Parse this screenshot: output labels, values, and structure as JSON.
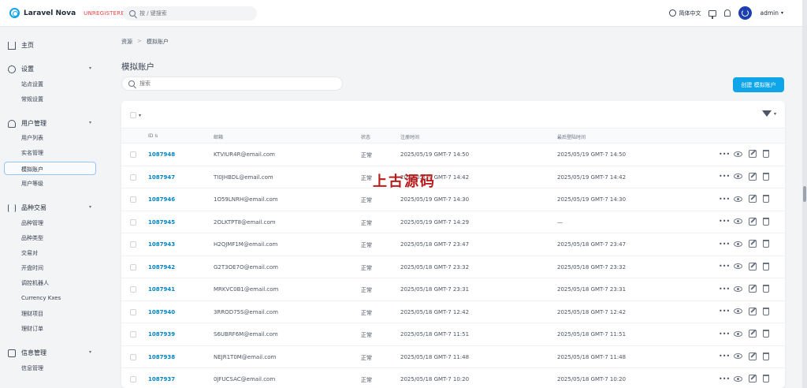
{
  "app": {
    "name": "Laravel Nova",
    "badge": "UNREGISTERED"
  },
  "global_search": {
    "placeholder": "按 / 键搜索"
  },
  "topbar": {
    "language": "简体中文",
    "user": "admin"
  },
  "sidebar": {
    "groups": [
      {
        "label": "主页",
        "items": []
      },
      {
        "label": "设置",
        "items": [
          "站点设置",
          "常规设置"
        ]
      },
      {
        "label": "用户管理",
        "items": [
          "用户列表",
          "实名管理",
          "模拟账户",
          "用户等级"
        ]
      },
      {
        "label": "品种交易",
        "items": [
          "品种管理",
          "品种类型",
          "交易对",
          "开盘时间",
          "调控机器人",
          "Currency Kxes",
          "理财项目",
          "理财订单"
        ]
      },
      {
        "label": "信息管理",
        "items": [
          "信息管理"
        ]
      }
    ],
    "active_item": "模拟账户"
  },
  "breadcrumb": {
    "root": "资源",
    "separator": ">",
    "current": "模拟账户"
  },
  "page": {
    "title": "模拟账户",
    "search_placeholder": "搜索",
    "create_button": "创建 模拟账户"
  },
  "table": {
    "columns": {
      "id": "ID",
      "email": "邮箱",
      "status": "状态",
      "registered": "注册时间",
      "last_login": "最后登陆时间"
    },
    "rows": [
      {
        "id": "1087948",
        "email": "KTVIUR4R@email.com",
        "status": "正常",
        "registered": "2025/05/19 GMT-7 14:50",
        "last_login": "2025/05/19 GMT-7 14:50"
      },
      {
        "id": "1087947",
        "email": "TI0JHBDL@email.com",
        "status": "正常",
        "registered": "2025/05/19 GMT-7 14:42",
        "last_login": "2025/05/19 GMT-7 14:42"
      },
      {
        "id": "1087946",
        "email": "1O59LNRH@email.com",
        "status": "正常",
        "registered": "2025/05/19 GMT-7 14:30",
        "last_login": "2025/05/19 GMT-7 14:30"
      },
      {
        "id": "1087945",
        "email": "2OLKTPT8@email.com",
        "status": "正常",
        "registered": "2025/05/19 GMT-7 14:29",
        "last_login": "—"
      },
      {
        "id": "1087943",
        "email": "H2QJMF1M@email.com",
        "status": "正常",
        "registered": "2025/05/18 GMT-7 23:47",
        "last_login": "2025/05/18 GMT-7 23:47"
      },
      {
        "id": "1087942",
        "email": "G2T3OE7O@email.com",
        "status": "正常",
        "registered": "2025/05/18 GMT-7 23:32",
        "last_login": "2025/05/18 GMT-7 23:32"
      },
      {
        "id": "1087941",
        "email": "MRKVC0B1@email.com",
        "status": "正常",
        "registered": "2025/05/18 GMT-7 23:31",
        "last_login": "2025/05/18 GMT-7 23:31"
      },
      {
        "id": "1087940",
        "email": "3RROD75S@email.com",
        "status": "正常",
        "registered": "2025/05/18 GMT-7 12:42",
        "last_login": "2025/05/18 GMT-7 12:42"
      },
      {
        "id": "1087939",
        "email": "S6UBRF6M@email.com",
        "status": "正常",
        "registered": "2025/05/18 GMT-7 11:51",
        "last_login": "2025/05/18 GMT-7 11:51"
      },
      {
        "id": "1087938",
        "email": "NEJR1T0M@email.com",
        "status": "正常",
        "registered": "2025/05/18 GMT-7 11:48",
        "last_login": "2025/05/18 GMT-7 11:48"
      },
      {
        "id": "1087937",
        "email": "0JFUCSAC@email.com",
        "status": "正常",
        "registered": "2025/05/18 GMT-7 10:20",
        "last_login": "2025/05/18 GMT-7 10:20"
      }
    ]
  },
  "watermark": "上古源码",
  "colors": {
    "accent": "#0ea5e9",
    "link": "#0284c7",
    "unregistered": "#ef4444",
    "watermark": "#b91c1c"
  }
}
